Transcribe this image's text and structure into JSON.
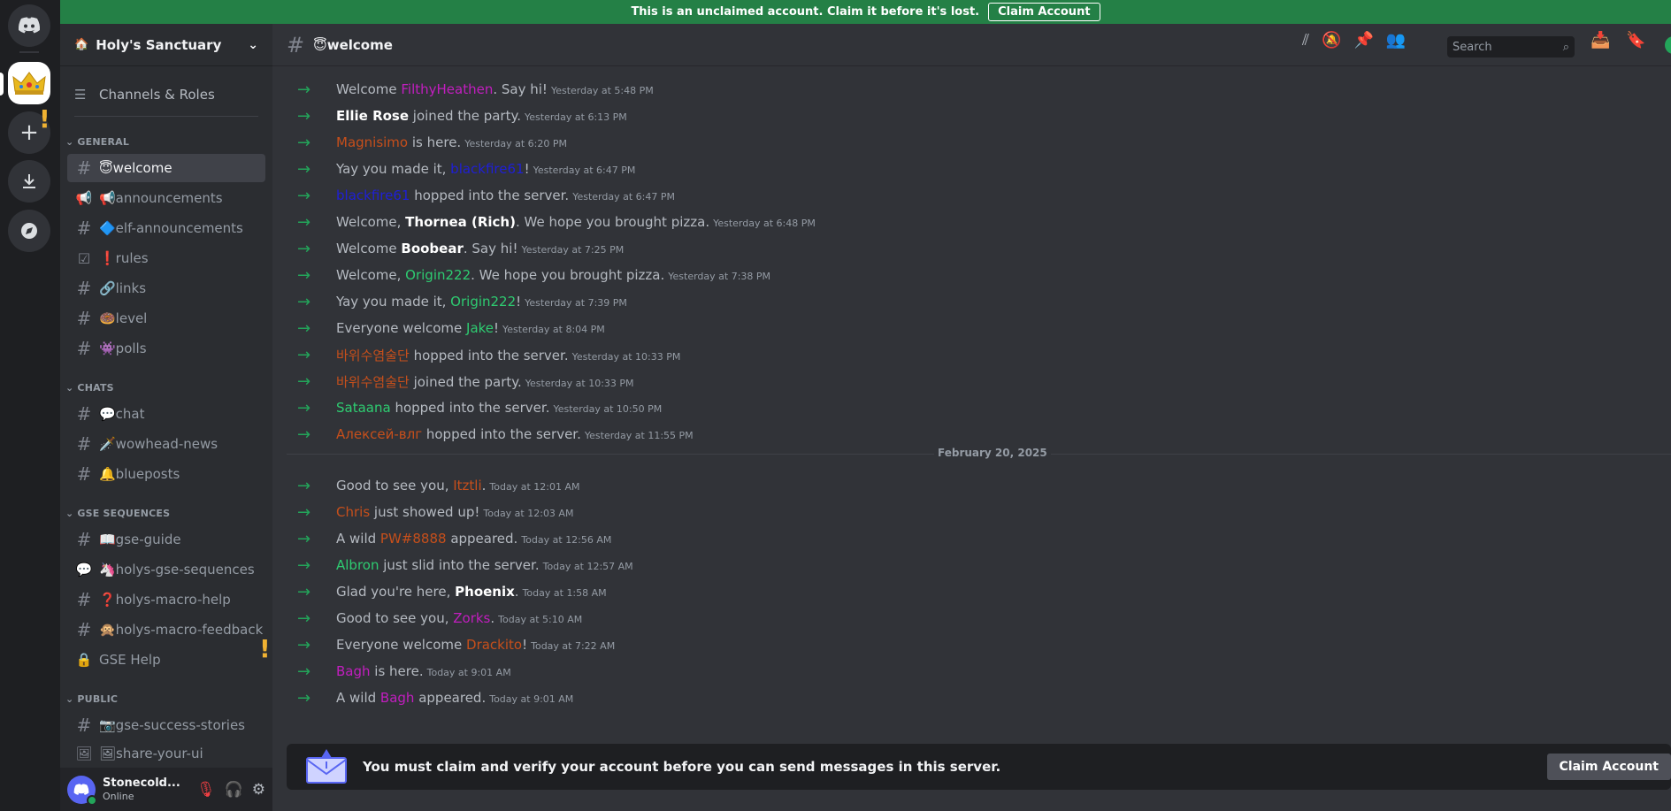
{
  "banner": {
    "text": "This is an unclaimed account. Claim it before it's lost.",
    "button": "Claim Account"
  },
  "server": {
    "name": "Holy's Sanctuary"
  },
  "sidebar": {
    "roles_label": "Channels & Roles",
    "categories": [
      "GENERAL",
      "CHATS",
      "GSE SEQUENCES",
      "PUBLIC"
    ],
    "channels": [
      {
        "label": "😇welcome",
        "icon": "hash"
      },
      {
        "label": "📢announcements",
        "icon": "megaphone"
      },
      {
        "label": "🔷elf-announcements",
        "icon": "hash"
      },
      {
        "label": "❗rules",
        "icon": "checkbox"
      },
      {
        "label": "🔗links",
        "icon": "hash"
      },
      {
        "label": "🍩level",
        "icon": "hash"
      },
      {
        "label": "👾polls",
        "icon": "hash"
      },
      {
        "label": "💬chat",
        "icon": "hash"
      },
      {
        "label": "🗡️wowhead-news",
        "icon": "hash"
      },
      {
        "label": "🔔blueposts",
        "icon": "hash"
      },
      {
        "label": "📖gse-guide",
        "icon": "hash"
      },
      {
        "label": "🦄holys-gse-sequences",
        "icon": "forum"
      },
      {
        "label": "❓holys-macro-help",
        "icon": "hash"
      },
      {
        "label": "🙊holys-macro-feedback",
        "icon": "hash"
      },
      {
        "label": "GSE Help",
        "icon": "lock"
      },
      {
        "label": "📷gse-success-stories",
        "icon": "hash"
      },
      {
        "label": "🖼share-your-ui",
        "icon": "image"
      }
    ]
  },
  "user": {
    "name": "Stonecold...",
    "status": "Online"
  },
  "topbar": {
    "channel": "😇welcome",
    "search_placeholder": "Search"
  },
  "messages": [
    {
      "pre": "Welcome ",
      "who": "FilthyHeathen",
      "color": "#c21ebf",
      "post": ". Say hi!",
      "ts": "Yesterday at 5:48 PM"
    },
    {
      "pre": "",
      "who": "Ellie Rose",
      "color": "#ffffff",
      "post": " joined the party.",
      "ts": "Yesterday at 6:13 PM"
    },
    {
      "pre": "",
      "who": "Magnisimo",
      "color": "#c64f1b",
      "post": " is here.",
      "ts": "Yesterday at 6:20 PM"
    },
    {
      "pre": "Yay you made it, ",
      "who": "blackfire61",
      "color": "#1f1fd6",
      "post": "!",
      "ts": "Yesterday at 6:47 PM"
    },
    {
      "pre": "",
      "who": "blackfire61",
      "color": "#1f1fd6",
      "post": " hopped into the server.",
      "ts": "Yesterday at 6:47 PM"
    },
    {
      "pre": "Welcome, ",
      "who": "Thornea (Rich)",
      "color": "#ffffff",
      "post": ". We hope you brought pizza.",
      "ts": "Yesterday at 6:48 PM"
    },
    {
      "pre": "Welcome ",
      "who": "Boobear",
      "color": "#ffffff",
      "post": ". Say hi!",
      "ts": "Yesterday at 7:25 PM"
    },
    {
      "pre": "Welcome, ",
      "who": "Origin222",
      "color": "#2ecc71",
      "post": ". We hope you brought pizza.",
      "ts": "Yesterday at 7:38 PM"
    },
    {
      "pre": "Yay you made it, ",
      "who": "Origin222",
      "color": "#2ecc71",
      "post": "!",
      "ts": "Yesterday at 7:39 PM"
    },
    {
      "pre": "Everyone welcome ",
      "who": "Jake",
      "color": "#2ecc71",
      "post": "!",
      "ts": "Yesterday at 8:04 PM"
    },
    {
      "pre": "",
      "who": "바위수염술단",
      "color": "#c64f1b",
      "post": " hopped into the server.",
      "ts": "Yesterday at 10:33 PM"
    },
    {
      "pre": "",
      "who": "바위수염술단",
      "color": "#c64f1b",
      "post": " joined the party.",
      "ts": "Yesterday at 10:33 PM"
    },
    {
      "pre": "",
      "who": "Sataana",
      "color": "#2ecc71",
      "post": " hopped into the server.",
      "ts": "Yesterday at 10:50 PM"
    },
    {
      "pre": "",
      "who": "Алексей-влг",
      "color": "#c64f1b",
      "post": " hopped into the server.",
      "ts": "Yesterday at 11:55 PM"
    },
    {
      "pre": "Good to see you, ",
      "who": "Itztli",
      "color": "#c64f1b",
      "post": ".",
      "ts": "Today at 12:01 AM"
    },
    {
      "pre": "",
      "who": "Chris",
      "color": "#c64f1b",
      "post": " just showed up!",
      "ts": "Today at 12:03 AM"
    },
    {
      "pre": "A wild ",
      "who": "PW#8888",
      "color": "#c64f1b",
      "post": " appeared.",
      "ts": "Today at 12:56 AM"
    },
    {
      "pre": "",
      "who": "Albron",
      "color": "#2ecc71",
      "post": " just slid into the server.",
      "ts": "Today at 12:57 AM"
    },
    {
      "pre": "Glad you're here, ",
      "who": "Phoenix",
      "color": "#ffffff",
      "post": ".",
      "ts": "Today at 1:58 AM"
    },
    {
      "pre": "Good to see you, ",
      "who": "Zorks",
      "color": "#c21ebf",
      "post": ".",
      "ts": "Today at 5:10 AM"
    },
    {
      "pre": "Everyone welcome ",
      "who": "Drackito",
      "color": "#c64f1b",
      "post": "!",
      "ts": "Today at 7:22 AM"
    },
    {
      "pre": "",
      "who": "Bagh",
      "color": "#c21ebf",
      "post": " is here.",
      "ts": "Today at 9:01 AM"
    },
    {
      "pre": "A wild ",
      "who": "Bagh",
      "color": "#c21ebf",
      "post": " appeared.",
      "ts": "Today at 9:01 AM"
    }
  ],
  "date_divider": "February 20, 2025",
  "claim": {
    "text": "You must claim and verify your account before you can send messages in this server.",
    "button": "Claim Account"
  }
}
